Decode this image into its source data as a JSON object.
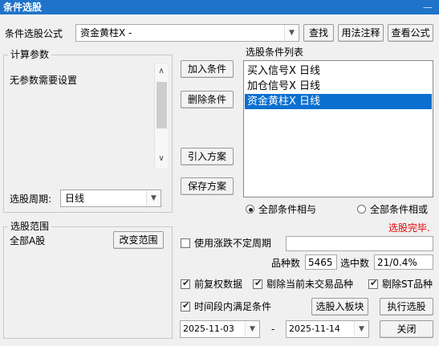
{
  "window": {
    "title": "条件选股",
    "close_glyph": "—"
  },
  "formula": {
    "label": "条件选股公式",
    "value": "资金黄柱X  -",
    "find_button": "查找",
    "usage_button": "用法注释",
    "view_button": "查看公式"
  },
  "params": {
    "group_title": "计算参数",
    "empty_text": "无参数需要设置",
    "period_label": "选股周期:",
    "period_value": "日线"
  },
  "actions": {
    "add_condition": "加入条件",
    "delete_condition": "删除条件",
    "import_scheme": "引入方案",
    "save_scheme": "保存方案"
  },
  "conditions": {
    "title": "选股条件列表",
    "items": [
      {
        "text": "买入信号X  日线",
        "selected": false
      },
      {
        "text": "加仓信号X  日线",
        "selected": false
      },
      {
        "text": "资金黄柱X  日线",
        "selected": true
      }
    ],
    "and_label": "全部条件相与",
    "or_label": "全部条件相或",
    "mode": "and"
  },
  "status": {
    "text": "选股完毕.",
    "color": "#e60000"
  },
  "range": {
    "group_title": "选股范围",
    "value": "全部A股",
    "change_button": "改变范围"
  },
  "options": {
    "variable_period_label": "使用涨跌不定周期",
    "variable_period_checked": false,
    "variable_period_value": "",
    "stock_count_label": "品种数",
    "stock_count": "5465",
    "selected_label": "选中数",
    "selected_value": "21/0.4%",
    "forward_adjust_label": "前复权数据",
    "forward_adjust_checked": true,
    "exclude_untraded_label": "剔除当前未交易品种",
    "exclude_untraded_checked": true,
    "exclude_st_label": "剔除ST品种",
    "exclude_st_checked": true,
    "time_range_label": "时间段内满足条件",
    "time_range_checked": true
  },
  "dates": {
    "start": "2025-11-03",
    "separator": "-",
    "end": "2025-11-14"
  },
  "bottom_buttons": {
    "to_block": "选股入板块",
    "execute": "执行选股",
    "close": "关闭"
  },
  "colors": {
    "titlebar": "#1f73c9",
    "selection": "#0b6fd0"
  }
}
